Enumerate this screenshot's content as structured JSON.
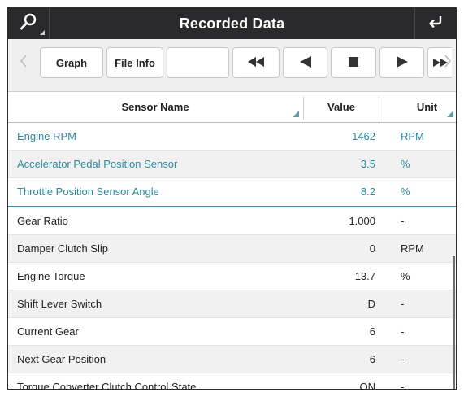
{
  "header": {
    "title": "Recorded Data"
  },
  "toolbar": {
    "graph_label": "Graph",
    "file_info_label": "File Info",
    "blank_label": ""
  },
  "table": {
    "columns": [
      "Sensor Name",
      "Value",
      "Unit"
    ],
    "pinned_rows": [
      {
        "name": "Engine RPM",
        "value": "1462",
        "unit": "RPM"
      },
      {
        "name": "Accelerator Pedal Position Sensor",
        "value": "3.5",
        "unit": "%"
      },
      {
        "name": "Throttle Position Sensor Angle",
        "value": "8.2",
        "unit": "%"
      }
    ],
    "rows": [
      {
        "name": "Gear Ratio",
        "value": "1.000",
        "unit": "-"
      },
      {
        "name": "Damper Clutch Slip",
        "value": "0",
        "unit": "RPM"
      },
      {
        "name": "Engine Torque",
        "value": "13.7",
        "unit": "%"
      },
      {
        "name": "Shift Lever Switch",
        "value": "D",
        "unit": "-"
      },
      {
        "name": "Current Gear",
        "value": "6",
        "unit": "-"
      },
      {
        "name": "Next Gear Position",
        "value": "6",
        "unit": "-"
      },
      {
        "name": "Torque Converter Clutch Control State",
        "value": "ON",
        "unit": "-"
      }
    ]
  },
  "colors": {
    "titlebar": "#2a2a2c",
    "accent": "#2c8aa0"
  },
  "icons": [
    "search-icon",
    "back-icon",
    "chevron-left-icon",
    "rewind-icon",
    "step-back-icon",
    "stop-icon",
    "play-icon",
    "fast-forward-icon",
    "chevron-right-icon"
  ]
}
